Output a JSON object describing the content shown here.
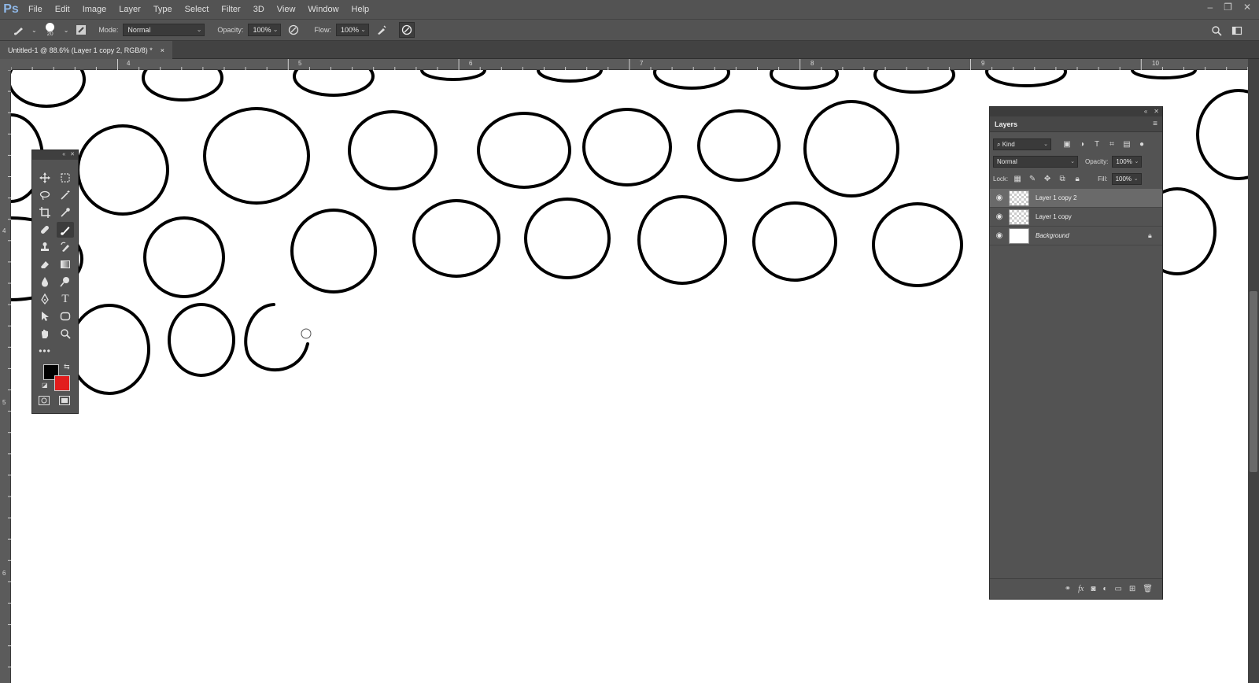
{
  "app": {
    "logo": "Ps"
  },
  "menu": [
    "File",
    "Edit",
    "Image",
    "Layer",
    "Type",
    "Select",
    "Filter",
    "3D",
    "View",
    "Window",
    "Help"
  ],
  "options_bar": {
    "brush_size": "20",
    "mode_label": "Mode:",
    "mode_value": "Normal",
    "opacity_label": "Opacity:",
    "opacity_value": "100%",
    "flow_label": "Flow:",
    "flow_value": "100%"
  },
  "document_tab": {
    "title": "Untitled-1 @ 88.6% (Layer 1 copy 2, RGB/8) *",
    "close": "×"
  },
  "rulers": {
    "top": [
      "4",
      "5",
      "6",
      "7",
      "8",
      "9",
      "10"
    ],
    "left": [
      "4",
      "5",
      "6"
    ]
  },
  "toolbox": {
    "foreground_color": "#000000",
    "background_color": "#e21d1d",
    "tools": [
      "move-icon",
      "marquee-icon",
      "lasso-icon",
      "magic-wand-icon",
      "crop-icon",
      "eyedropper-icon",
      "healing-icon",
      "brush-icon",
      "stamp-icon",
      "history-brush-icon",
      "eraser-icon",
      "gradient-icon",
      "blur-icon",
      "dodge-icon",
      "pen-icon",
      "type-icon",
      "path-select-icon",
      "shape-icon",
      "hand-icon",
      "zoom-icon",
      "more-icon"
    ]
  },
  "layers_panel": {
    "title": "Layers",
    "filter_kind": "Kind",
    "blend_mode": "Normal",
    "opacity_label": "Opacity:",
    "opacity_value": "100%",
    "lock_label": "Lock:",
    "fill_label": "Fill:",
    "fill_value": "100%",
    "layers": [
      {
        "name": "Layer 1 copy 2",
        "selected": true,
        "thumb": "transparent"
      },
      {
        "name": "Layer 1 copy",
        "selected": false,
        "thumb": "transparent"
      },
      {
        "name": "Background",
        "selected": false,
        "thumb": "white",
        "locked": true
      }
    ],
    "footer_icons": [
      "link-icon",
      "fx-icon",
      "mask-icon",
      "adjustment-icon",
      "folder-icon",
      "new-layer-icon",
      "trash-icon"
    ]
  }
}
